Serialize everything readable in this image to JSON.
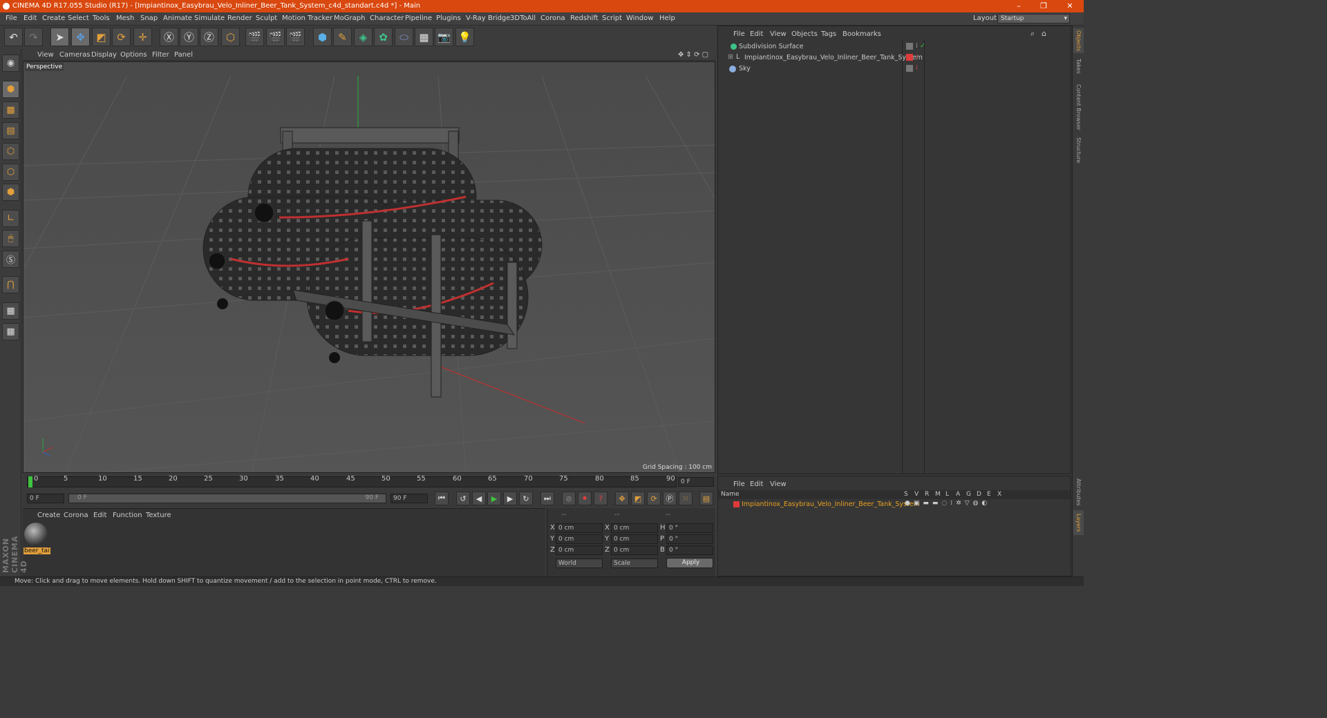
{
  "window": {
    "title": "CINEMA 4D R17.055 Studio (R17) - [Impiantinox_Easybrau_Velo_Inliner_Beer_Tank_System_c4d_standart.c4d *] - Main",
    "minimize": "–",
    "maximize": "❐",
    "close": "✕"
  },
  "menu": [
    "File",
    "Edit",
    "Create",
    "Select",
    "Tools",
    "Mesh",
    "Snap",
    "Animate",
    "Simulate",
    "Render",
    "Sculpt",
    "Motion Tracker",
    "MoGraph",
    "Character",
    "Pipeline",
    "Plugins",
    "V-Ray Bridge",
    "3DToAll",
    "Corona",
    "Redshift",
    "Script",
    "Window",
    "Help"
  ],
  "layout": {
    "label": "Layout:",
    "value": "Startup"
  },
  "viewport": {
    "menu": [
      "View",
      "Cameras",
      "Display",
      "Options",
      "Filter",
      "Panel"
    ],
    "label": "Perspective",
    "grid_spacing": "Grid Spacing : 100 cm"
  },
  "timeline": {
    "ticks": [
      "0",
      "5",
      "10",
      "15",
      "20",
      "25",
      "30",
      "35",
      "40",
      "45",
      "50",
      "55",
      "60",
      "65",
      "70",
      "75",
      "80",
      "85",
      "90"
    ],
    "current_frame": "0 F",
    "start_field": "0 F",
    "range_start": "0 F",
    "range_end": "90 F",
    "end_field": "90 F"
  },
  "material_panel": {
    "menu": [
      "Create",
      "Corona",
      "Edit",
      "Function",
      "Texture"
    ],
    "material_name": "beer_tai"
  },
  "coords": {
    "headers": [
      "--",
      "--",
      "--"
    ],
    "rows": [
      {
        "a": "X",
        "av": "0 cm",
        "b": "X",
        "bv": "0 cm",
        "c": "H",
        "cv": "0 °"
      },
      {
        "a": "Y",
        "av": "0 cm",
        "b": "Y",
        "bv": "0 cm",
        "c": "P",
        "cv": "0 °"
      },
      {
        "a": "Z",
        "av": "0 cm",
        "b": "Z",
        "bv": "0 cm",
        "c": "B",
        "cv": "0 °"
      }
    ],
    "world": "World",
    "scale": "Scale",
    "apply": "Apply"
  },
  "object_manager": {
    "menu": [
      "File",
      "Edit",
      "View",
      "Objects",
      "Tags",
      "Bookmarks"
    ],
    "objects": [
      {
        "name": "Subdivision Surface",
        "indent": 0
      },
      {
        "name": "Impiantinox_Easybrau_Velo_Inliner_Beer_Tank_System",
        "indent": 1
      },
      {
        "name": "Sky",
        "indent": 0
      }
    ]
  },
  "layer_manager": {
    "menu": [
      "File",
      "Edit",
      "View"
    ],
    "name_header": "Name",
    "columns": [
      "S",
      "V",
      "R",
      "M",
      "L",
      "A",
      "G",
      "D",
      "E",
      "X"
    ],
    "layer_name": "Impiantinox_Easybrau_Velo_Inliner_Beer_Tank_System"
  },
  "side_tabs": [
    "Objects",
    "Takes",
    "Content Browser",
    "Structure"
  ],
  "side_tabs_bottom": [
    "Attributes",
    "Layers"
  ],
  "brand": "MAXON CINEMA 4D",
  "status": "Move: Click and drag to move elements. Hold down SHIFT to quantize movement / add to the selection in point mode, CTRL to remove.",
  "colors": {
    "titlebar": "#d9480f",
    "accent": "#e2a03c",
    "layer_red": "#e03a3a",
    "layer_text": "#e8a020"
  }
}
